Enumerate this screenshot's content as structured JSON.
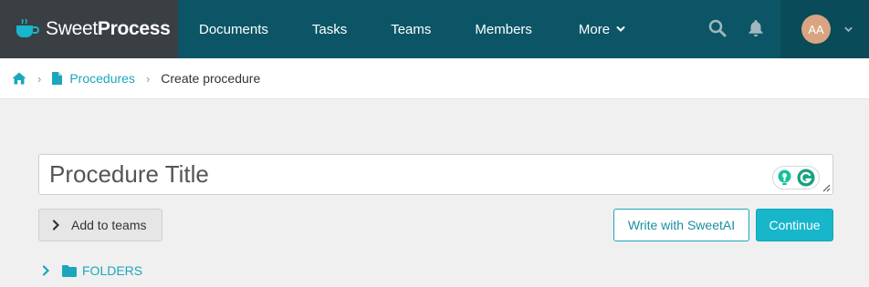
{
  "brand": {
    "name_light": "Sweet",
    "name_bold": "Process"
  },
  "nav": {
    "items": [
      {
        "label": "Documents"
      },
      {
        "label": "Tasks"
      },
      {
        "label": "Teams"
      },
      {
        "label": "Members"
      },
      {
        "label": "More"
      }
    ]
  },
  "user": {
    "initials": "AA"
  },
  "breadcrumb": {
    "procedures": "Procedures",
    "current": "Create procedure"
  },
  "form": {
    "title_placeholder": "Procedure Title",
    "title_value": "",
    "add_to_teams": "Add to teams",
    "write_with_ai": "Write with SweetAI",
    "continue": "Continue",
    "folders": "FOLDERS"
  },
  "colors": {
    "topbar": "#0b5566",
    "brand_bg": "#3a3f44",
    "accent": "#17b6cb",
    "link": "#1ba7bb",
    "avatar": "#d8a482"
  },
  "icons": [
    "cup-logo-icon",
    "chevron-down-icon",
    "search-icon",
    "bell-icon",
    "home-icon",
    "document-icon",
    "chevron-right-icon",
    "folder-icon",
    "grammarly-icon"
  ]
}
